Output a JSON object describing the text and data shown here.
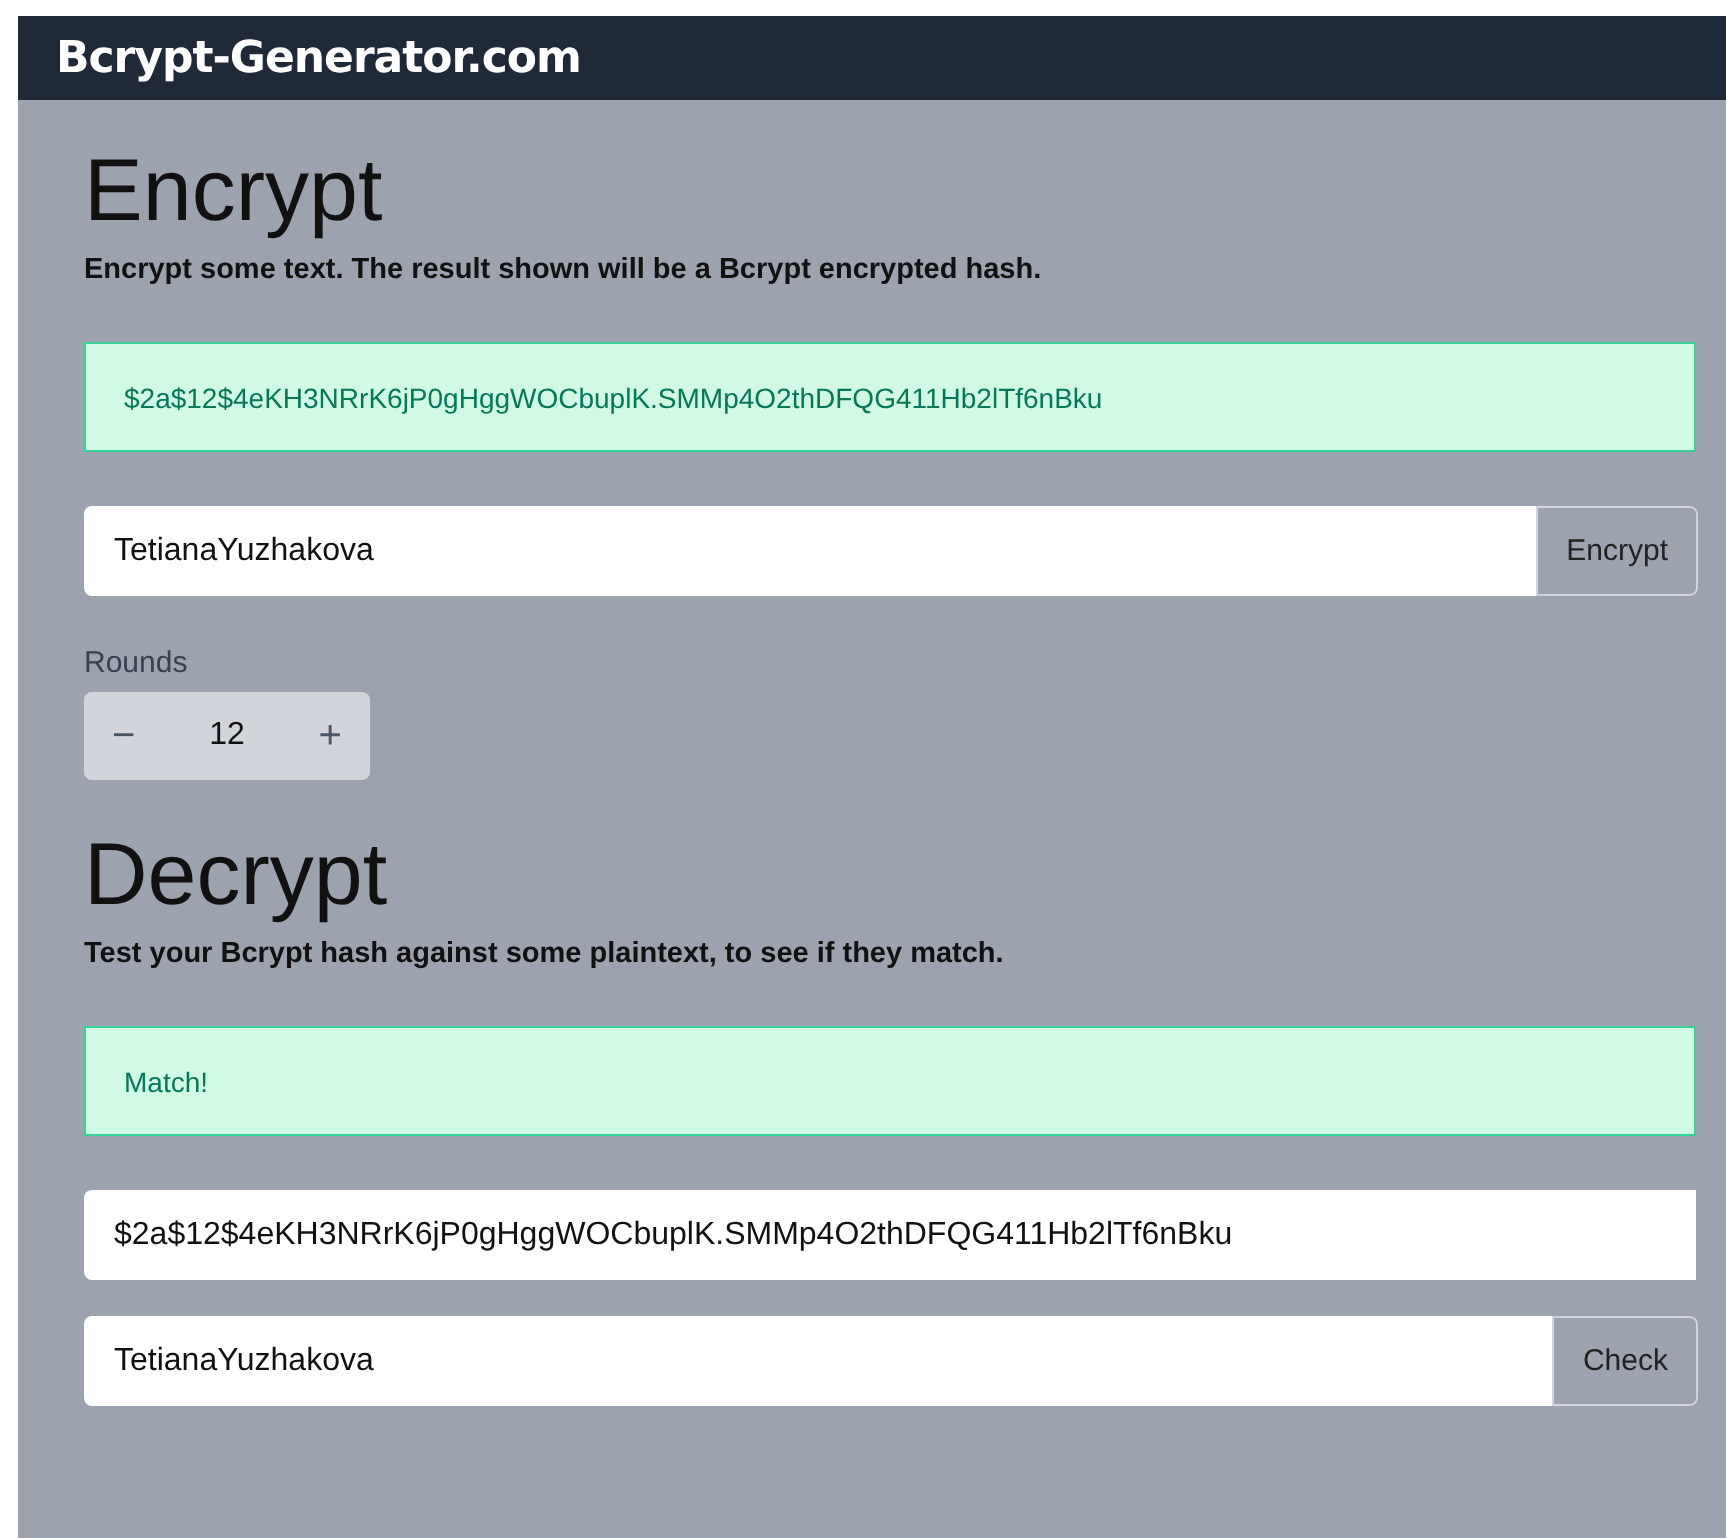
{
  "header": {
    "title": "Bcrypt-Generator.com"
  },
  "encrypt": {
    "heading": "Encrypt",
    "description": "Encrypt some text. The result shown will be a Bcrypt encrypted hash.",
    "result": "$2a$12$4eKH3NRrK6jP0gHggWOCbuplK.SMMp4O2thDFQG411Hb2lTf6nBku",
    "input": "TetianaYuzhakova",
    "button": "Encrypt",
    "rounds_label": "Rounds",
    "rounds": {
      "minus": "−",
      "value": "12",
      "plus": "+"
    }
  },
  "decrypt": {
    "heading": "Decrypt",
    "description": "Test your Bcrypt hash against some plaintext, to see if they match.",
    "result": "Match!",
    "hash_input": "$2a$12$4eKH3NRrK6jP0gHggWOCbuplK.SMMp4O2thDFQG411Hb2lTf6nBku",
    "input": "TetianaYuzhakova",
    "button": "Check"
  }
}
